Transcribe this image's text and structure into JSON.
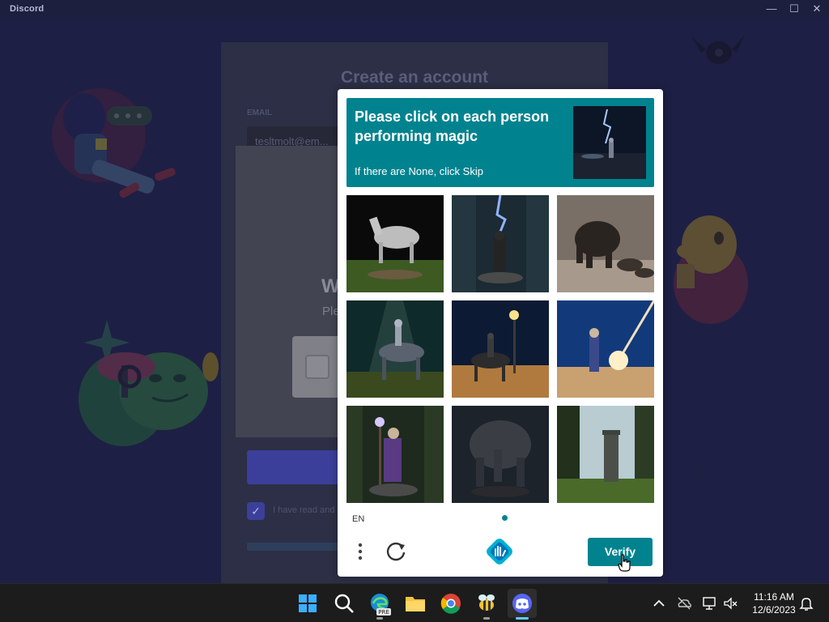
{
  "window": {
    "title": "Discord",
    "controls": [
      "—",
      "☐",
      "✕"
    ]
  },
  "register": {
    "title": "Create an account",
    "email_label": "EMAIL",
    "email_value": "tesltmolt@em...",
    "tos_text": "I have read and"
  },
  "verify_modal": {
    "heading": "W",
    "subtext": "Ple"
  },
  "captcha": {
    "prompt": "Please click on each person performing magic",
    "skip_hint": "If there are None, click Skip",
    "language": "EN",
    "verify_label": "Verify",
    "tiles": [
      {
        "name": "tile-horse-statue"
      },
      {
        "name": "tile-figure-lightning"
      },
      {
        "name": "tile-elephant-rocks"
      },
      {
        "name": "tile-horse-rider-light"
      },
      {
        "name": "tile-rider-desert-lamp"
      },
      {
        "name": "tile-wizard-beam"
      },
      {
        "name": "tile-wizard-staff"
      },
      {
        "name": "tile-elephant-statue"
      },
      {
        "name": "tile-forest-tower"
      }
    ],
    "colors": {
      "accent": "#00838f"
    }
  },
  "taskbar": {
    "apps": [
      "start-icon",
      "search-icon",
      "edge-icon",
      "file-explorer-icon",
      "chrome-icon",
      "bee-app-icon",
      "discord-icon"
    ],
    "clock": {
      "time": "11:16 AM",
      "date": "12/6/2023"
    }
  }
}
